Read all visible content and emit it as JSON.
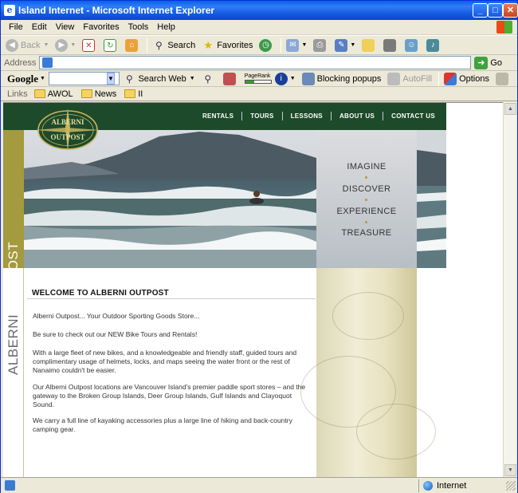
{
  "window": {
    "title": "Island Internet - Microsoft Internet Explorer",
    "minimize_label": "_",
    "maximize_label": "□",
    "close_label": "✕"
  },
  "menu": [
    "File",
    "Edit",
    "View",
    "Favorites",
    "Tools",
    "Help"
  ],
  "toolbar": {
    "back_label": "Back",
    "search_label": "Search",
    "favorites_label": "Favorites"
  },
  "address": {
    "label": "Address",
    "value": "",
    "go_label": "Go"
  },
  "googlebar": {
    "logo": "Google",
    "search_web_label": "Search Web",
    "pagerank_label": "PageRank",
    "blocking_label": "Blocking popups",
    "autofill_label": "AutoFill",
    "options_label": "Options"
  },
  "links": {
    "label": "Links",
    "items": [
      "AWOL",
      "News",
      "II"
    ]
  },
  "site": {
    "vertical_title_a": "ALBERNI",
    "vertical_title_b": "OUTPOST",
    "logo_top": "ALBERNI",
    "logo_bottom": "OUTPOST",
    "nav": [
      "RENTALS",
      "TOURS",
      "LESSONS",
      "ABOUT US",
      "CONTACT US"
    ],
    "taglines": [
      "IMAGINE",
      "DISCOVER",
      "EXPERIENCE",
      "TREASURE"
    ],
    "welcome_heading": "WELCOME TO ALBERNI OUTPOST",
    "paragraphs": [
      "Alberni Outpost... Your Outdoor Sporting Goods Store...",
      "Be sure to check out our NEW Bike Tours and Rentals!",
      "With a large fleet of new bikes, and a knowledgeable and friendly staff, guided tours and complimentary usage of helmets, locks, and maps seeing the water front or the rest of Nanaimo couldn't be easier.",
      "Our Alberni Outpost locations are Vancouver Island's premier paddle sport stores – and the gateway to the Broken Group Islands, Deer Group Islands, Gulf Islands and Clayoquot Sound.",
      "We carry a full line of kayaking accessories plus a large line of hiking and back-country camping gear."
    ]
  },
  "status": {
    "zone": "Internet"
  },
  "colors": {
    "site_green": "#1d4a2a",
    "site_gold": "#a49a3e",
    "xp_blue": "#0a5fe9"
  }
}
